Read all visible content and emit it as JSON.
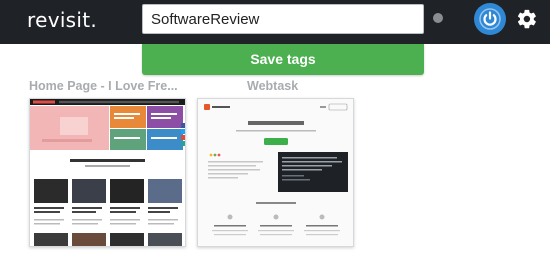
{
  "app": {
    "logo": "revisit."
  },
  "tags": {
    "input_value": "SoftwareReview",
    "save_label": "Save tags"
  },
  "cards": [
    {
      "title": "Home Page - I Love Fre...",
      "site_name": "ilovefreesoftware",
      "featured_heading": "FEATURED ARTICLES"
    },
    {
      "title": "Webtask",
      "site_name": "webtask",
      "hero_title": "All you need is code",
      "cta": "Try it Now",
      "section_title": "Use webtask for ...",
      "features": [
        "Serverless Applications",
        "Programmable Webhooks",
        "Web Task Runners"
      ]
    }
  ],
  "colors": {
    "topbar": "#1f2327",
    "save_button": "#4caf50",
    "power_icon": "#2e88d6",
    "card_title": "#a8acaf"
  },
  "icons": [
    "power-icon",
    "gear-icon",
    "status-dot"
  ]
}
